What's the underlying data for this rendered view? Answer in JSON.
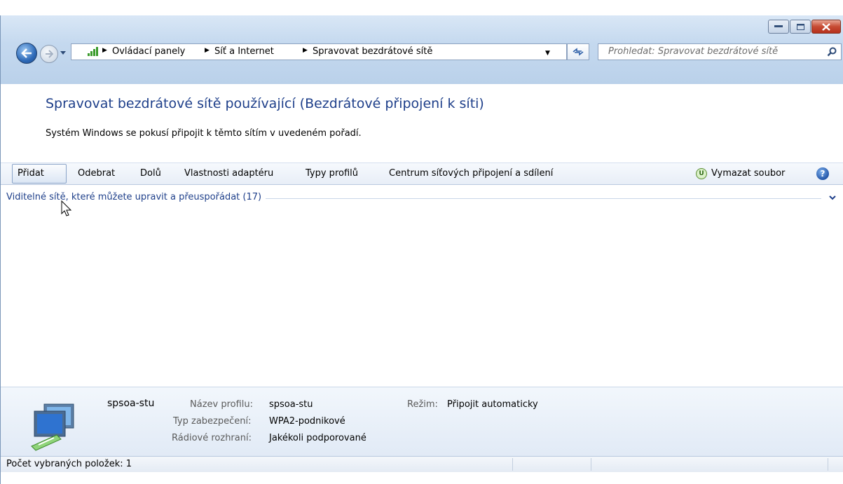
{
  "window": {
    "caption_buttons": [
      "minimize",
      "maximize",
      "close"
    ]
  },
  "address_bar": {
    "breadcrumbs": [
      "Ovládací panely",
      "Síť a Internet",
      "Spravovat bezdrátové sítě"
    ],
    "search_placeholder": "Prohledat: Spravovat bezdrátové sítě"
  },
  "header": {
    "title": "Spravovat bezdrátové sítě používající (Bezdrátové připojení k síti)",
    "subtitle": "Systém Windows se pokusí připojit k těmto sítím v uvedeném pořadí."
  },
  "toolbar": {
    "add": "Přidat",
    "remove": "Odebrat",
    "move_down": "Dolů",
    "adapter_properties": "Vlastnosti adaptéru",
    "profile_types": "Typy profilů",
    "network_center": "Centrum síťových připojení a sdílení",
    "delete_file": "Vymazat soubor",
    "u_icon_letter": "U",
    "help_glyph": "?"
  },
  "group": {
    "label": "Viditelné sítě, které můžete upravit a přeuspořádat (17)"
  },
  "details": {
    "network_name": "spsoa-stu",
    "profile_name_label": "Název profilu:",
    "profile_name_value": "spsoa-stu",
    "mode_label": "Režim:",
    "mode_value": "Připojit automaticky",
    "security_label": "Typ zabezpečení:",
    "security_value": "WPA2-podnikové",
    "radio_label": "Rádiové rozhraní:",
    "radio_value": "Jakékoli podporované"
  },
  "status_bar": {
    "selected_count": "Počet vybraných položek: 1"
  },
  "colors": {
    "title_blue": "#1e3f8a",
    "frame": "#c5d9ef",
    "close_red": "#c74b33"
  }
}
